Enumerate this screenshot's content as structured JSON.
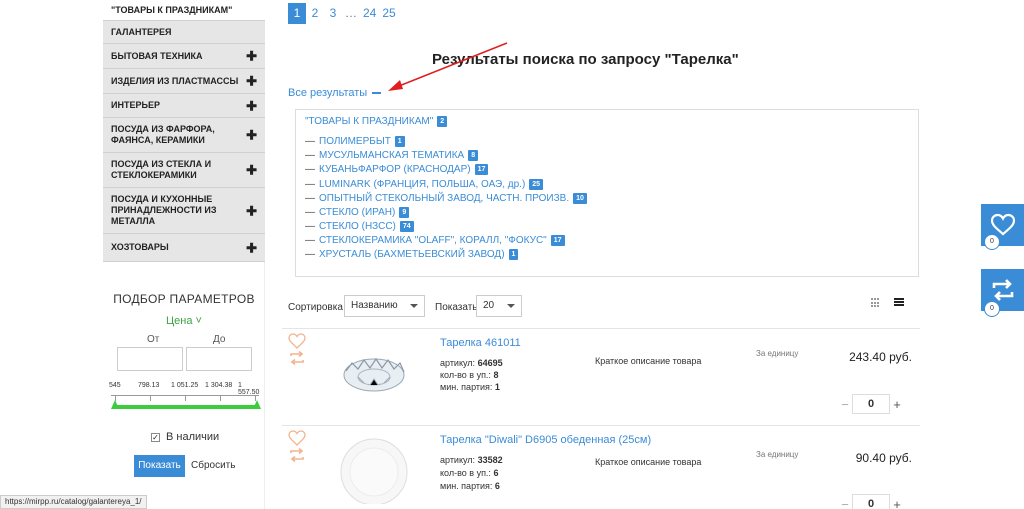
{
  "sidebar": {
    "categories": [
      {
        "label": "\"ТОВАРЫ К ПРАЗДНИКАМ\"",
        "has_sub": false
      },
      {
        "label": "ГАЛАНТЕРЕЯ",
        "has_sub": false
      },
      {
        "label": "БЫТОВАЯ ТЕХНИКА",
        "has_sub": true
      },
      {
        "label": "ИЗДЕЛИЯ ИЗ ПЛАСТМАССЫ",
        "has_sub": true
      },
      {
        "label": "ИНТЕРЬЕР",
        "has_sub": true
      },
      {
        "label": "ПОСУДА ИЗ ФАРФОРА, ФАЯНСА, КЕРАМИКИ",
        "has_sub": true
      },
      {
        "label": "ПОСУДА ИЗ СТЕКЛА И СТЕКЛОКЕРАМИКИ",
        "has_sub": true
      },
      {
        "label": "ПОСУДА И КУХОННЫЕ ПРИНАДЛЕЖНОСТИ ИЗ МЕТАЛЛА",
        "has_sub": true
      },
      {
        "label": "ХОЗТОВАРЫ",
        "has_sub": true
      }
    ],
    "plus_sign": "✚"
  },
  "filter": {
    "title": "ПОДБОР ПАРАМЕТРОВ",
    "price_toggle": "Цена ˅",
    "from_label": "От",
    "to_label": "До",
    "scale": [
      "545",
      "798.13",
      "1 051.25",
      "1 304.38",
      "1 557.50"
    ],
    "instock_label": "В наличии",
    "instock_checked": true,
    "show_button": "Показать",
    "reset_button": "Сбросить"
  },
  "status_url": "https://mirpp.ru/catalog/galantereya_1/",
  "pagination": {
    "pages": [
      "1",
      "2",
      "3",
      "…",
      "24",
      "25"
    ],
    "current": "1"
  },
  "heading": "Результаты поиска по запросу \"Тарелка\"",
  "all_results": "Все результаты",
  "results": {
    "top": {
      "label": "\"ТОВАРЫ К ПРАЗДНИКАМ\"",
      "count": "2"
    },
    "items": [
      {
        "label": "ПОЛИМЕРБЫТ",
        "count": "1"
      },
      {
        "label": "МУСУЛЬМАНСКАЯ ТЕМАТИКА",
        "count": "8"
      },
      {
        "label": "КУБАНЬФАРФОР (КРАСНОДАР)",
        "count": "17"
      },
      {
        "label": "LUMINARK (ФРАНЦИЯ, ПОЛЬША, ОАЭ, др.)",
        "count": "25"
      },
      {
        "label": "ОПЫТНЫЙ СТЕКОЛЬНЫЙ ЗАВОД, ЧАСТН. ПРОИЗВ.",
        "count": "10"
      },
      {
        "label": "СТЕКЛО (ИРАН)",
        "count": "9"
      },
      {
        "label": "СТЕКЛО (НЗСС)",
        "count": "74"
      },
      {
        "label": "СТЕКЛОКЕРАМИКА \"OLAFF\", КОРАЛЛ, \"ФОКУС\"",
        "count": "17"
      },
      {
        "label": "ХРУСТАЛЬ (БАХМЕТЬЕВСКИЙ ЗАВОД)",
        "count": "1"
      }
    ],
    "dash": "—"
  },
  "toolbar": {
    "sort_label": "Сортировка",
    "sort_value": "Названию",
    "show_label": "Показать",
    "show_value": "20"
  },
  "products": [
    {
      "name": "Тарелка  461011",
      "article_label": "артикул:",
      "article": "64695",
      "pack_label": "кол-во в уп.:",
      "pack": "8",
      "min_label": "мин. партия:",
      "min": "1",
      "desc": "Краткое описание товара",
      "unit": "За единицу",
      "price": "243.40 руб.",
      "qty": "0"
    },
    {
      "name": "Тарелка \"Diwali\" D6905 обеденная (25см)",
      "article_label": "артикул:",
      "article": "33582",
      "pack_label": "кол-во в уп.:",
      "pack": "6",
      "min_label": "мин. партия:",
      "min": "6",
      "desc": "Краткое описание товара",
      "unit": "За единицу",
      "price": "90.40 руб.",
      "qty": "0"
    }
  ],
  "qty_minus": "−",
  "qty_plus": "+",
  "float": {
    "favorites_count": "0",
    "compare_count": "0"
  },
  "colors": {
    "accent": "#3a8cd6",
    "green": "#3ccc3c",
    "sidebar_bg": "#e6e6e6",
    "arrow": "#e02020"
  },
  "icons": [
    "plus-icon",
    "heart-icon",
    "compare-icon",
    "grid-view-icon",
    "list-view-icon",
    "check-icon"
  ]
}
